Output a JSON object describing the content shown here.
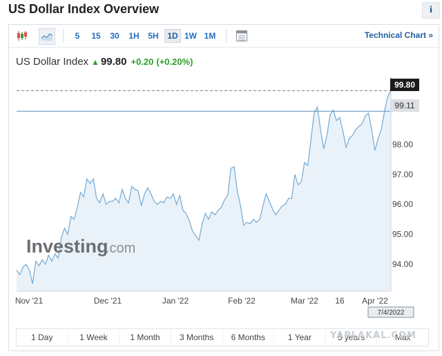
{
  "header": {
    "title": "US Dollar Index Overview",
    "info_label": "i"
  },
  "toolbar": {
    "timeframes": [
      "5",
      "15",
      "30",
      "1H",
      "5H",
      "1D",
      "1W",
      "1M"
    ],
    "active_timeframe": "1D",
    "technical_chart_label": "Technical Chart »"
  },
  "quote": {
    "name": "US Dollar Index",
    "price": "99.80",
    "change": "+0.20",
    "change_pct": "(+0.20%)"
  },
  "price_tags": {
    "last": "99.80",
    "reference": "99.11"
  },
  "date_tag": "7/4/2022",
  "watermark": {
    "brand": "Investing",
    "suffix": ".com"
  },
  "range_buttons": [
    "1 Day",
    "1 Week",
    "1 Month",
    "3 Months",
    "6 Months",
    "1 Year",
    "5 years",
    "Max"
  ],
  "site_watermark": "YAPLAKAL.COM",
  "colors": {
    "line": "#7aaed6",
    "area": "#eaf2f9",
    "positive": "#2b9e2b",
    "link": "#1f6fbf"
  },
  "chart_data": {
    "type": "area",
    "x_tick_labels": [
      "Nov '21",
      "Dec '21",
      "Jan '22",
      "Feb '22",
      "Mar '22",
      "16",
      "Apr '22"
    ],
    "y_tick_labels": [
      "94.00",
      "95.00",
      "96.00",
      "97.00",
      "98.00"
    ],
    "ylim": [
      93.1,
      100.2
    ],
    "last_value": 99.8,
    "reference_value": 99.11,
    "grid": false,
    "values": [
      93.8,
      93.65,
      93.9,
      94.0,
      93.8,
      93.35,
      94.1,
      93.95,
      94.15,
      94.0,
      94.3,
      94.1,
      94.35,
      94.2,
      94.9,
      95.2,
      95.0,
      95.6,
      95.5,
      95.9,
      96.4,
      96.25,
      96.85,
      96.7,
      96.85,
      96.2,
      96.05,
      96.35,
      96.0,
      96.1,
      96.1,
      96.2,
      96.05,
      96.5,
      96.2,
      96.05,
      96.6,
      96.5,
      96.45,
      95.95,
      96.35,
      96.55,
      96.35,
      96.1,
      96.0,
      96.1,
      96.05,
      96.25,
      96.2,
      96.35,
      96.0,
      96.3,
      95.8,
      95.7,
      95.45,
      95.1,
      94.95,
      94.8,
      95.35,
      95.7,
      95.5,
      95.75,
      95.65,
      95.8,
      95.9,
      96.15,
      96.3,
      97.2,
      97.25,
      96.45,
      95.95,
      95.3,
      95.4,
      95.35,
      95.5,
      95.4,
      95.5,
      95.95,
      96.35,
      96.1,
      95.85,
      95.65,
      95.8,
      95.95,
      96.0,
      96.2,
      96.2,
      97.0,
      96.65,
      96.75,
      97.4,
      97.3,
      98.15,
      99.05,
      99.25,
      98.5,
      97.85,
      98.3,
      99.0,
      99.15,
      98.8,
      98.9,
      98.45,
      97.9,
      98.2,
      98.3,
      98.5,
      98.6,
      98.7,
      98.95,
      99.05,
      98.5,
      97.8,
      98.2,
      98.5,
      99.1,
      99.6,
      99.8
    ]
  }
}
